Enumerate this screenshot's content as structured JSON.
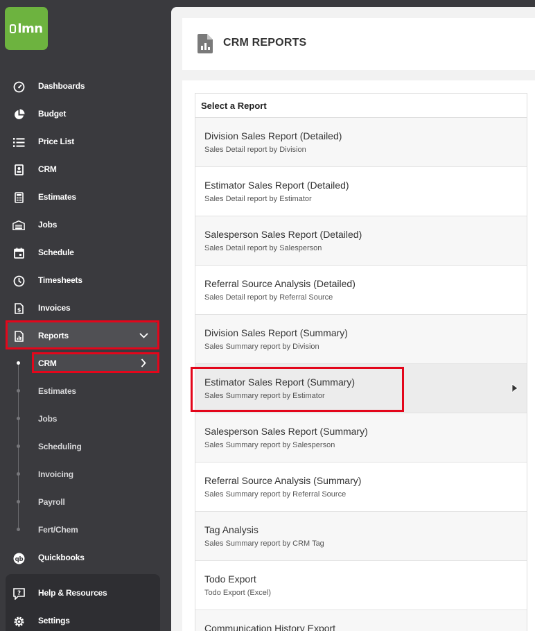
{
  "app": {
    "logo_text": "lmn"
  },
  "sidebar": {
    "items": [
      {
        "label": "Dashboards",
        "icon": "gauge-icon"
      },
      {
        "label": "Budget",
        "icon": "pie-chart-icon"
      },
      {
        "label": "Price List",
        "icon": "list-icon"
      },
      {
        "label": "CRM",
        "icon": "contact-card-icon"
      },
      {
        "label": "Estimates",
        "icon": "calculator-icon"
      },
      {
        "label": "Jobs",
        "icon": "garage-icon"
      },
      {
        "label": "Schedule",
        "icon": "calendar-icon"
      },
      {
        "label": "Timesheets",
        "icon": "clock-icon"
      },
      {
        "label": "Invoices",
        "icon": "invoice-icon"
      },
      {
        "label": "Reports",
        "icon": "report-icon"
      }
    ],
    "reports_sub": [
      "CRM",
      "Estimates",
      "Jobs",
      "Scheduling",
      "Invoicing",
      "Payroll",
      "Fert/Chem"
    ],
    "quickbooks": "Quickbooks",
    "help": "Help & Resources",
    "settings": "Settings"
  },
  "header": {
    "title": "CRM REPORTS"
  },
  "report_table": {
    "header": "Select a Report",
    "rows": [
      {
        "title": "Division Sales Report (Detailed)",
        "subtitle": "Sales Detail report by Division"
      },
      {
        "title": "Estimator Sales Report (Detailed)",
        "subtitle": "Sales Detail report by Estimator"
      },
      {
        "title": "Salesperson Sales Report (Detailed)",
        "subtitle": "Sales Detail report by Salesperson"
      },
      {
        "title": "Referral Source Analysis (Detailed)",
        "subtitle": "Sales Detail report by Referral Source"
      },
      {
        "title": "Division Sales Report (Summary)",
        "subtitle": "Sales Summary report by Division"
      },
      {
        "title": "Estimator Sales Report (Summary)",
        "subtitle": "Sales Summary report by Estimator"
      },
      {
        "title": "Salesperson Sales Report (Summary)",
        "subtitle": "Sales Summary report by Salesperson"
      },
      {
        "title": "Referral Source Analysis (Summary)",
        "subtitle": "Sales Summary report by Referral Source"
      },
      {
        "title": "Tag Analysis",
        "subtitle": "Sales Summary report by CRM Tag"
      },
      {
        "title": "Todo Export",
        "subtitle": "Todo Export (Excel)"
      },
      {
        "title": "Communication History Export",
        "subtitle": ""
      }
    ]
  },
  "colors": {
    "sidebar": "#3a3a3e",
    "brand": "#6db33f",
    "highlight": "#e3061b"
  }
}
